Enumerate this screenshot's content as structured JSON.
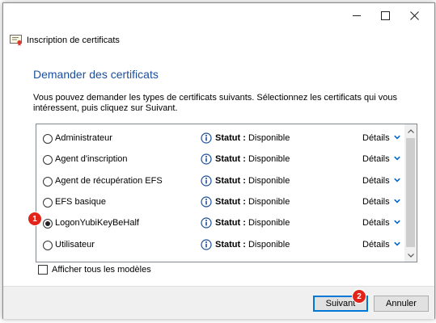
{
  "window": {
    "title": "Inscription de certificats",
    "minimize": "minimize",
    "maximize": "maximize",
    "close": "close"
  },
  "main": {
    "heading": "Demander des certificats",
    "description": "Vous pouvez demander les types de certificats suivants. Sélectionnez les certificats qui vous intéressent, puis cliquez sur Suivant."
  },
  "certificates": [
    {
      "name": "Administrateur",
      "status_label": "Statut :",
      "status_value": "Disponible",
      "details": "Détails",
      "selected": false
    },
    {
      "name": "Agent d'inscription",
      "status_label": "Statut :",
      "status_value": "Disponible",
      "details": "Détails",
      "selected": false
    },
    {
      "name": "Agent de récupération EFS",
      "status_label": "Statut :",
      "status_value": "Disponible",
      "details": "Détails",
      "selected": false
    },
    {
      "name": "EFS basique",
      "status_label": "Statut :",
      "status_value": "Disponible",
      "details": "Détails",
      "selected": false
    },
    {
      "name": "LogonYubiKeyBeHalf",
      "status_label": "Statut :",
      "status_value": "Disponible",
      "details": "Détails",
      "selected": true
    },
    {
      "name": "Utilisateur",
      "status_label": "Statut :",
      "status_value": "Disponible",
      "details": "Détails",
      "selected": false
    }
  ],
  "show_all_templates": {
    "label": "Afficher tous les modèles",
    "checked": false
  },
  "buttons": {
    "next": "Suivant",
    "cancel": "Annuler"
  },
  "markers": {
    "one": "1",
    "two": "2"
  },
  "colors": {
    "heading": "#1a4f9c",
    "marker": "#e2231a",
    "chevron": "#0066cc",
    "focus": "#0078d7"
  }
}
